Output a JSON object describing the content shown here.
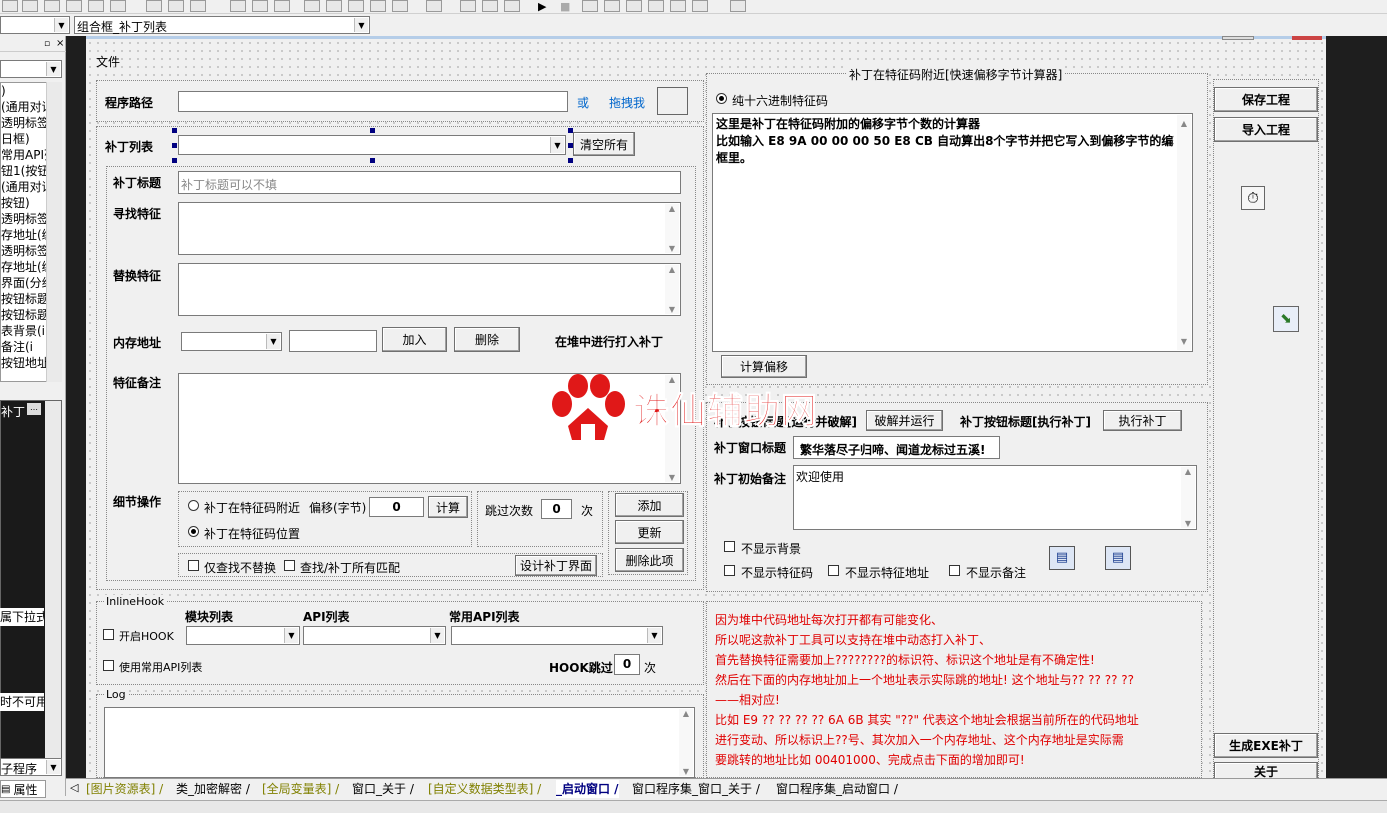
{
  "top_combo_left": "",
  "top_combo_right": "组合框_补丁列表",
  "form": {
    "menu_file": "文件",
    "program_path_label": "程序路径",
    "or_label": "或",
    "drag_label": "拖拽我",
    "patch_list_label": "补丁列表",
    "clear_all": "清空所有",
    "patch_title_label": "补丁标题",
    "patch_title_placeholder": "补丁标题可以不填",
    "find_feature_label": "寻找特征",
    "replace_feature_label": "替换特征",
    "mem_addr_label": "内存地址",
    "add_btn": "加入",
    "delete_btn": "删除",
    "heap_label": "在堆中进行打入补丁",
    "feature_note_label": "特征备注",
    "detail_label": "细节操作",
    "radio_near": "补丁在特征码附近",
    "offset_label": "偏移(字节)",
    "offset_value": "0",
    "calc_btn": "计算",
    "radio_pos": "补丁在特征码位置",
    "skip_label": "跳过次数",
    "skip_value": "0",
    "skip_unit": "次",
    "add_item_btn": "添加",
    "update_btn": "更新",
    "delete_item_btn": "删除此项",
    "only_find": "仅查找不替换",
    "find_all": "查找/补丁所有匹配",
    "design_btn": "设计补丁界面",
    "inline_hook_title": "InlineHook",
    "module_list": "模块列表",
    "api_list": "API列表",
    "common_api_list": "常用API列表",
    "enable_hook": "开启HOOK",
    "use_common_api": "使用常用API列表",
    "hook_skip": "HOOK跳过",
    "hook_skip_value": "0",
    "hook_skip_unit": "次",
    "log_title": "Log",
    "calc_group_title": "补丁在特征码附近[快速偏移字节计算器]",
    "pure_hex": "纯十六进制特征码",
    "calc_text_1": "这里是补丁在特征码附加的偏移字节个数的计算器",
    "calc_text_2": "比如输入 E8 9A 00 00 00 50 E8 CB 自动算出8个字节并把它写入到偏移字节的编辑",
    "calc_text_3": "框里。",
    "calc_offset_btn": "计算偏移",
    "crack_title_label": "补丁按钮标题[运行并破解]",
    "crack_run_btn": "破解并运行",
    "exec_title_label": "补丁按钮标题[执行补丁]",
    "exec_btn": "执行补丁",
    "window_title_label": "补丁窗口标题",
    "window_title_value": "繁华落尽子归啼、闻道龙标过五溪!",
    "initial_note_label": "补丁初始备注",
    "initial_note_value": "欢迎使用",
    "no_bg": "不显示背景",
    "no_feature": "不显示特征码",
    "no_feature_addr": "不显示特征地址",
    "no_note": "不显示备注",
    "info_lines": [
      "因为堆中代码地址每次打开都有可能变化、",
      "所以呢这款补丁工具可以支持在堆中动态打入补丁、",
      "首先替换特征需要加上????????的标识符、标识这个地址是有不确定性!",
      "然后在下面的内存地址加上一个地址表示实际跳的地址!  这个地址与?? ?? ?? ??",
      "——相对应!",
      "比如 E9 ?? ?? ?? ?? 6A 6B 其实 \"??\" 代表这个地址会根据当前所在的代码地址",
      "进行变动、所以标识上??号、其次加入一个内存地址、这个内存地址是实际需",
      "要跳转的地址比如 00401000、完成点击下面的增加即可!"
    ],
    "save_project": "保存工程",
    "import_project": "导入工程",
    "gen_exe": "生成EXE补丁",
    "close_btn": "关于",
    "watermark": "诛仙辅助网"
  },
  "left_panel": {
    "lines": [
      ")",
      "(通用对话",
      "透明标签",
      "日框)",
      "常用API列",
      "钮1(按钮",
      "(通用对话",
      "按钮)",
      "透明标签",
      "存地址(编",
      "透明标签",
      "存地址(编",
      "界面(分组",
      "按钮标题_",
      "按钮标题",
      "表背景(i",
      "备注(i",
      "按钮地址"
    ],
    "patch_label": "补丁",
    "dropdown_hint": "属下拉式",
    "unavailable_hint": "时不可用",
    "subprogram": "子程序",
    "property_tab": "属性"
  },
  "tabs": [
    {
      "label": "[图片资源表]",
      "color": "#808000"
    },
    {
      "label": "类_加密解密",
      "color": "#000000"
    },
    {
      "label": "[全局变量表]",
      "color": "#808000"
    },
    {
      "label": "窗口_关于",
      "color": "#000000"
    },
    {
      "label": "[自定义数据类型表]",
      "color": "#808000"
    },
    {
      "label": "_启动窗口",
      "color": "#000080"
    },
    {
      "label": "窗口程序集_窗口_关于",
      "color": "#000000"
    },
    {
      "label": "窗口程序集_启动窗口",
      "color": "#000000"
    }
  ],
  "colors": {
    "red_text": "#e00000",
    "blue_link": "#0066cc",
    "watermark": "#e01818"
  }
}
